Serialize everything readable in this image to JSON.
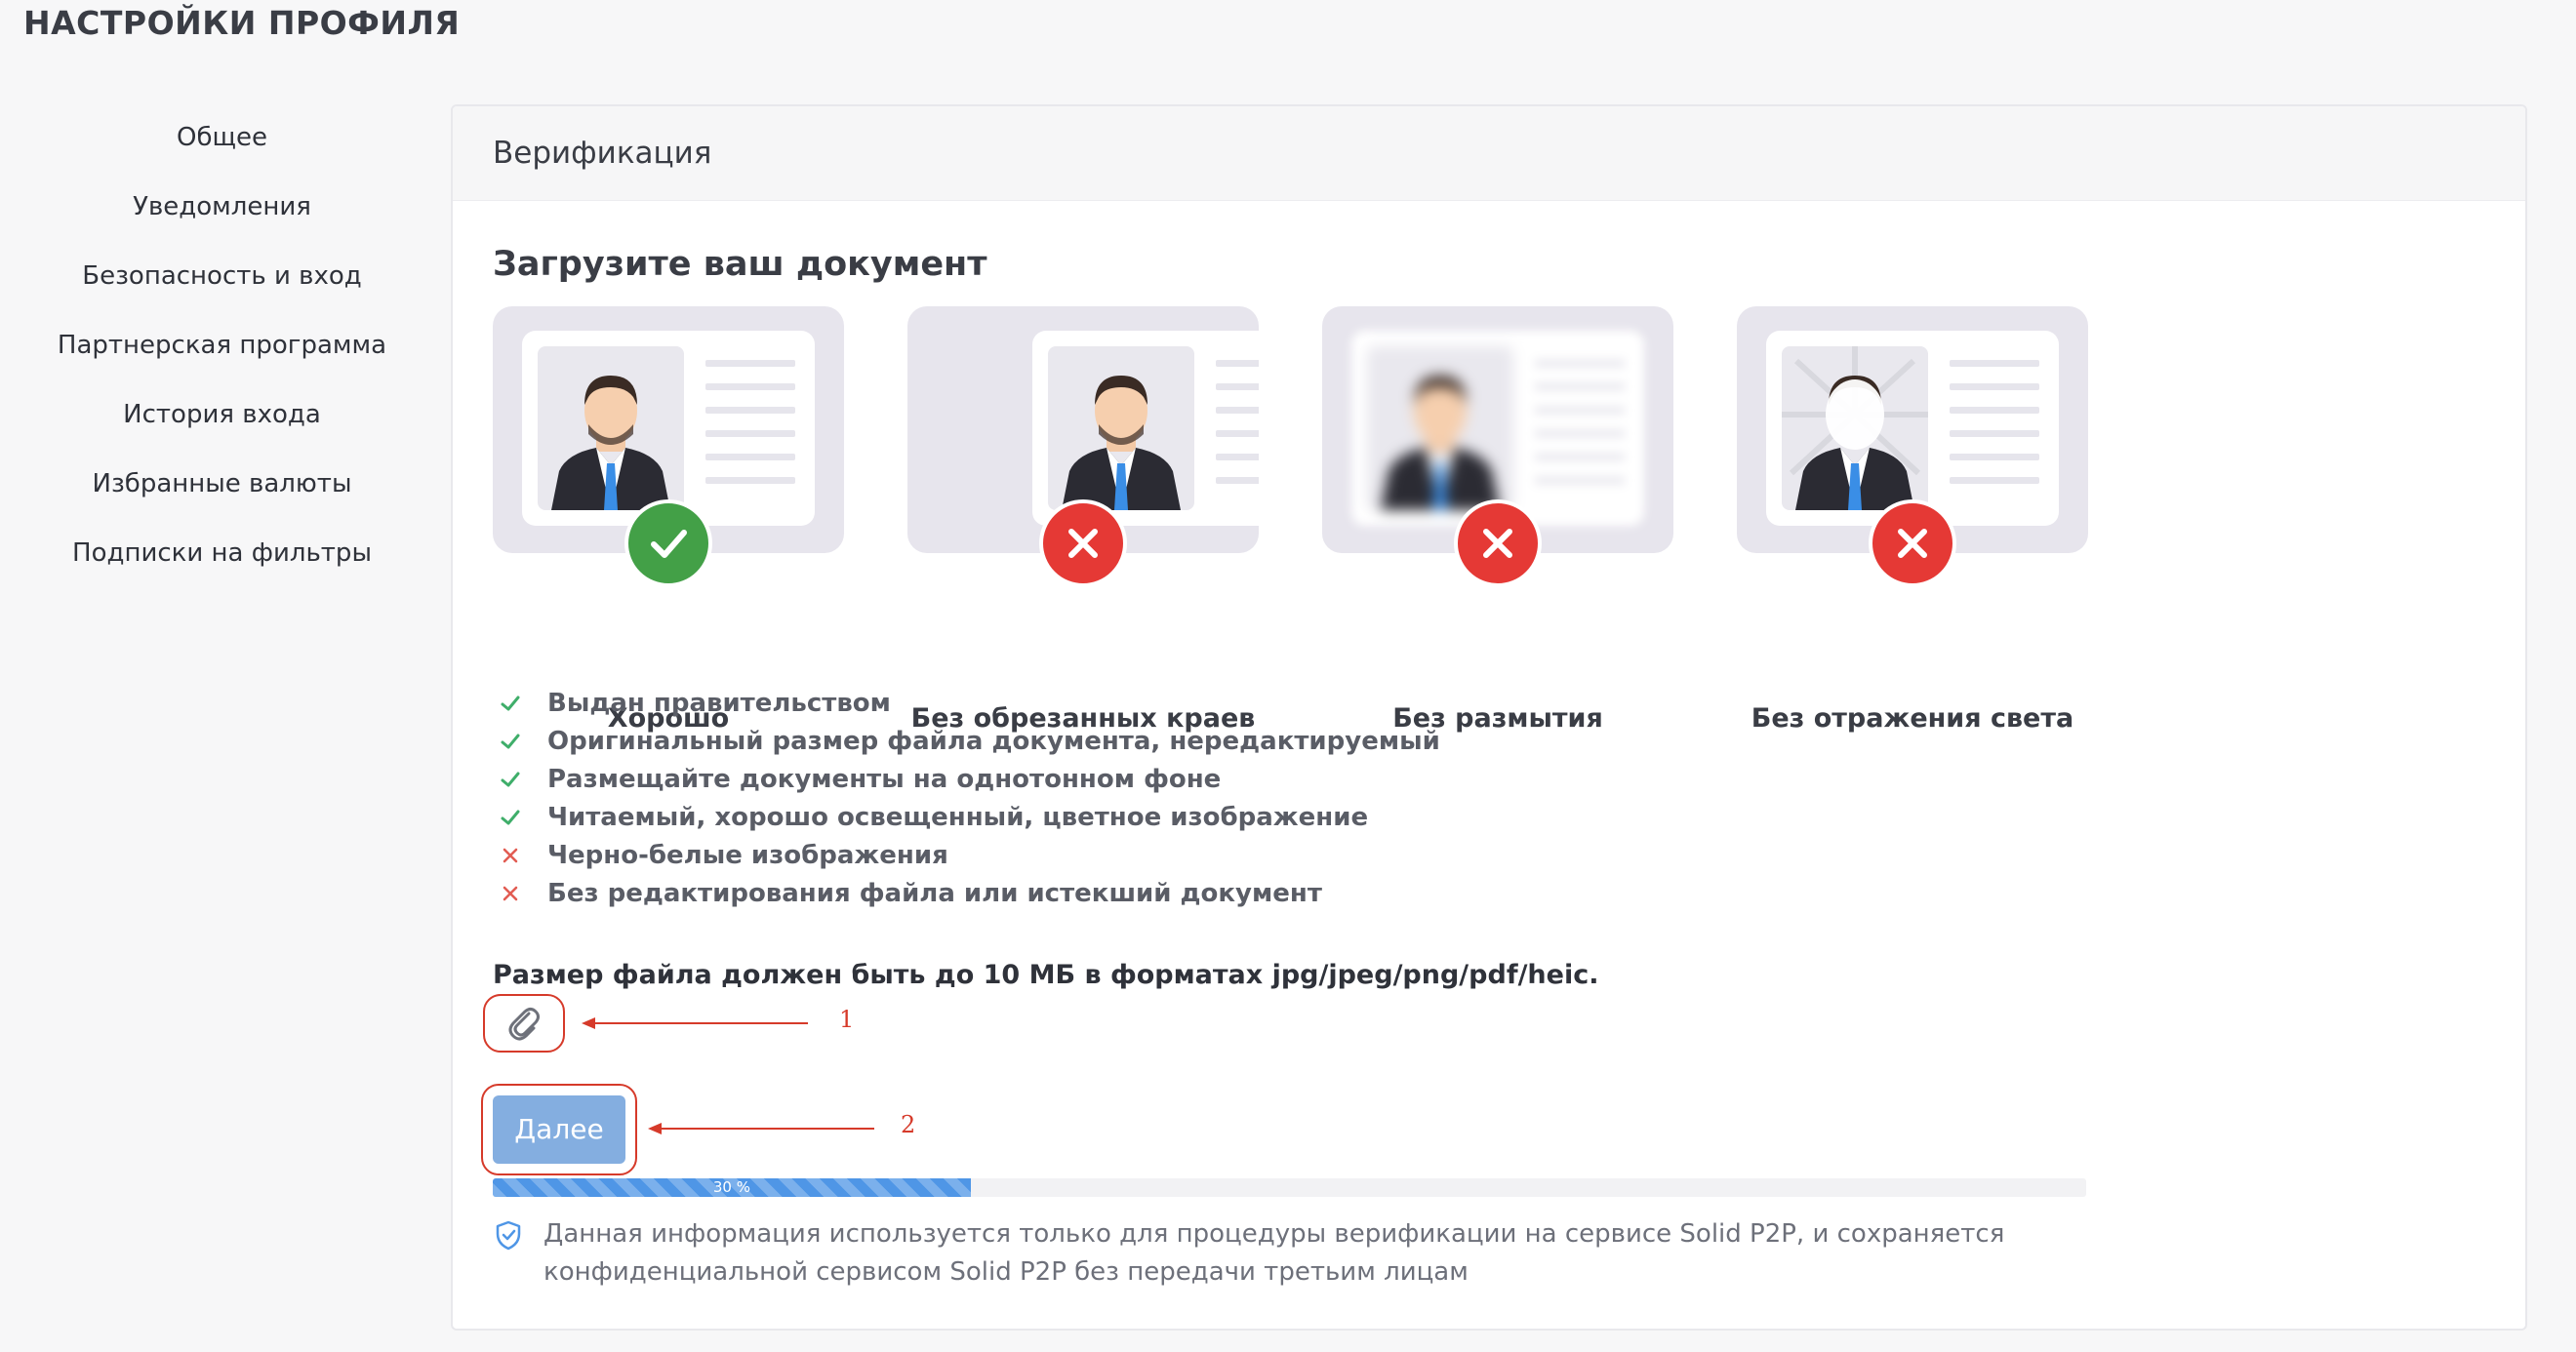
{
  "page": {
    "title": "НАСТРОЙКИ ПРОФИЛЯ"
  },
  "sidebar": {
    "items": [
      {
        "label": "Общее"
      },
      {
        "label": "Уведомления"
      },
      {
        "label": "Безопасность и вход"
      },
      {
        "label": "Партнерская программа"
      },
      {
        "label": "История входа"
      },
      {
        "label": "Избранные валюты"
      },
      {
        "label": "Подписки на фильтры"
      }
    ]
  },
  "verification": {
    "header": "Верификация",
    "upload_title": "Загрузите ваш документ",
    "examples": [
      {
        "label": "Хорошо",
        "status": "good",
        "icon": "check-icon"
      },
      {
        "label": "Без обрезанных краев",
        "status": "bad",
        "icon": "cross-icon"
      },
      {
        "label": "Без размытия",
        "status": "bad",
        "icon": "cross-icon"
      },
      {
        "label": "Без отражения света",
        "status": "bad",
        "icon": "cross-icon"
      }
    ],
    "requirements": [
      {
        "text": "Выдан правительством",
        "ok": true
      },
      {
        "text": "Оригинальный размер файла документа, нередактируемый",
        "ok": true
      },
      {
        "text": "Размещайте документы на однотонном фоне",
        "ok": true
      },
      {
        "text": "Читаемый, хорошо освещенный, цветное изображение",
        "ok": true
      },
      {
        "text": "Черно-белые изображения",
        "ok": false
      },
      {
        "text": "Без редактирования файла или истекший документ",
        "ok": false
      }
    ],
    "file_note": "Размер файла должен быть до 10 МБ в форматах jpg/jpeg/png/pdf/heic.",
    "attach_icon": "paperclip-icon",
    "next_label": "Далее",
    "progress": {
      "percent": 30,
      "text": "30 %"
    },
    "privacy_icon": "shield-check-icon",
    "privacy_text": "Данная информация используется только для процедуры верификации на сервисе Solid P2P, и сохраняется конфиденциальной сервисом Solid P2P без передачи третьим лицам"
  },
  "annotations": {
    "marker_1": "1",
    "marker_2": "2"
  },
  "colors": {
    "good": "#43a047",
    "bad": "#e53935",
    "check": "#3fae6a",
    "button": "#84aee0",
    "progress": "#4f96e6",
    "annotation": "#d63a2a"
  }
}
